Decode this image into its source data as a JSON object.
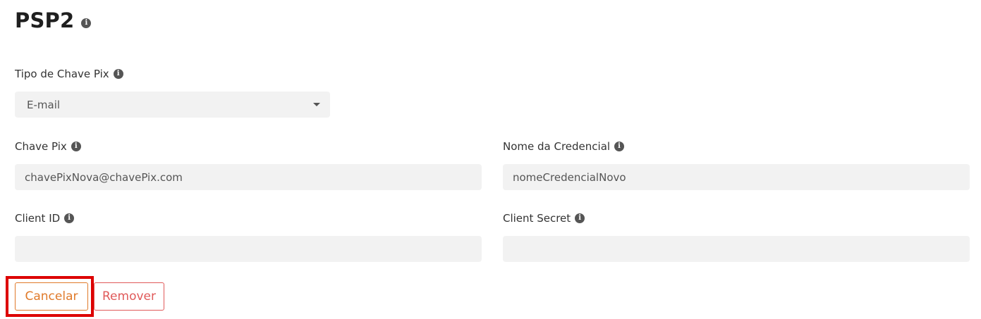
{
  "page": {
    "title": "PSP2"
  },
  "form": {
    "pix_key_type": {
      "label": "Tipo de Chave Pix",
      "selected": "E-mail"
    },
    "pix_key": {
      "label": "Chave Pix",
      "value": "chavePixNova@chavePix.com"
    },
    "credential_name": {
      "label": "Nome da Credencial",
      "value": "nomeCredencialNovo"
    },
    "client_id": {
      "label": "Client ID",
      "value": ""
    },
    "client_secret": {
      "label": "Client Secret",
      "value": ""
    }
  },
  "actions": {
    "cancel_label": "Cancelar",
    "remove_label": "Remover"
  },
  "icons": {
    "info": "info-icon",
    "select_caret": "caret-down-icon"
  },
  "colors": {
    "cancel": "#e07a2a",
    "remove": "#e05a5a",
    "highlight": "#dd0000",
    "field_bg": "#f2f2f2"
  }
}
